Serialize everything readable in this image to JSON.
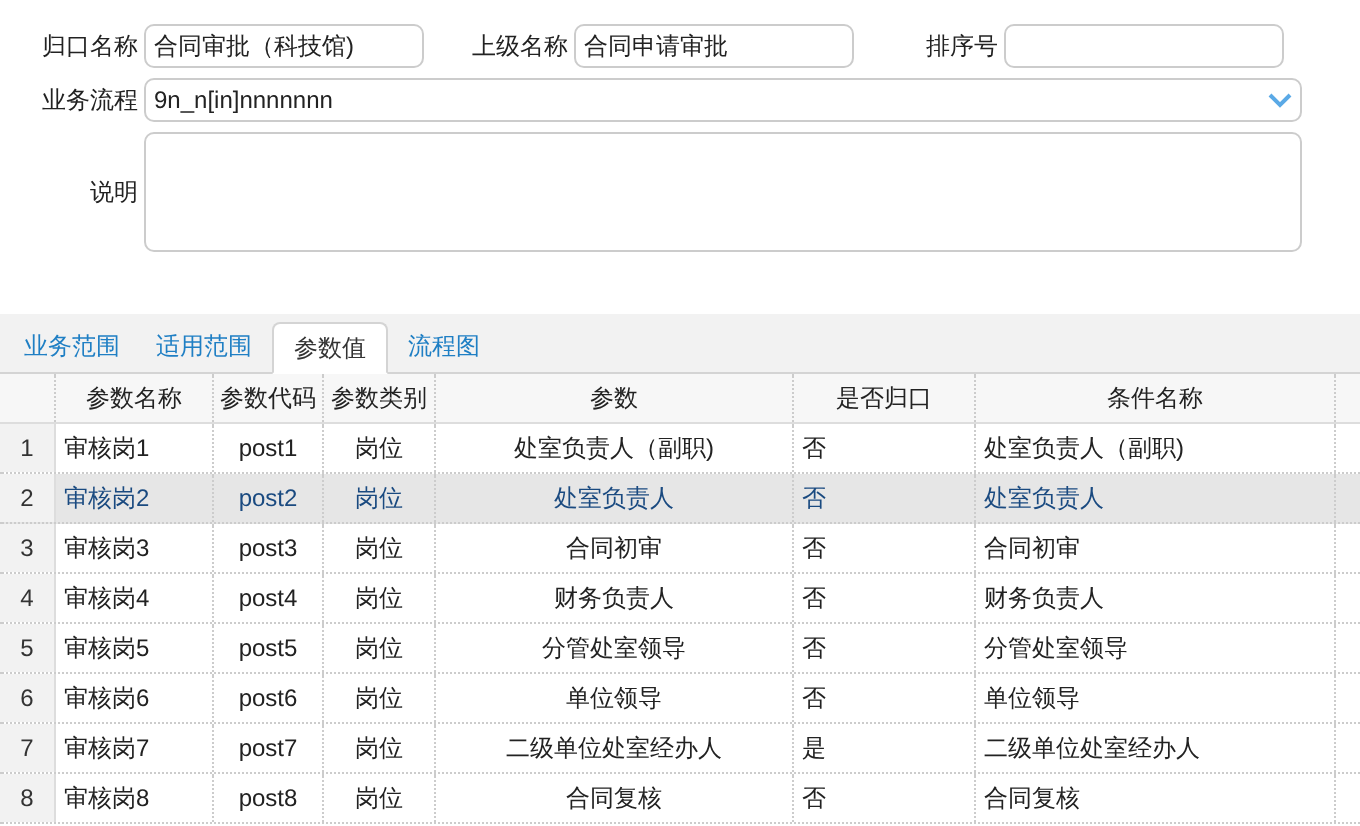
{
  "form": {
    "fields": [
      {
        "label": "归口名称",
        "value": "合同审批（科技馆)"
      },
      {
        "label": "上级名称",
        "value": "合同申请审批"
      },
      {
        "label": "排序号"
      }
    ],
    "process": {
      "label": "业务流程",
      "value": "9n_n[in]nnnnnnn"
    },
    "description": {
      "label": "说明"
    }
  },
  "tabs": [
    {
      "label": "业务范围",
      "selected": false
    },
    {
      "label": "适用范围",
      "selected": false
    },
    {
      "label": "参数值",
      "selected": true
    },
    {
      "label": "流程图",
      "selected": false
    }
  ],
  "table": {
    "columns": [
      "参数名称",
      "参数代码",
      "参数类别",
      "参数",
      "是否归口",
      "条件名称"
    ],
    "rows": [
      {
        "num": "1",
        "cells": [
          "审核岗1",
          "post1",
          "岗位",
          "处室负责人（副职)",
          "否",
          "处室负责人（副职)"
        ],
        "selected": false
      },
      {
        "num": "2",
        "cells": [
          "审核岗2",
          "post2",
          "岗位",
          "处室负责人",
          "否",
          "处室负责人"
        ],
        "selected": true
      },
      {
        "num": "3",
        "cells": [
          "审核岗3",
          "post3",
          "岗位",
          "合同初审",
          "否",
          "合同初审"
        ],
        "selected": false
      },
      {
        "num": "4",
        "cells": [
          "审核岗4",
          "post4",
          "岗位",
          "财务负责人",
          "否",
          "财务负责人"
        ],
        "selected": false
      },
      {
        "num": "5",
        "cells": [
          "审核岗5",
          "post5",
          "岗位",
          "分管处室领导",
          "否",
          "分管处室领导"
        ],
        "selected": false
      },
      {
        "num": "6",
        "cells": [
          "审核岗6",
          "post6",
          "岗位",
          "单位领导",
          "否",
          "单位领导"
        ],
        "selected": false
      },
      {
        "num": "7",
        "cells": [
          "审核岗7",
          "post7",
          "岗位",
          "二级单位处室经办人",
          "是",
          "二级单位处室经办人"
        ],
        "selected": false
      },
      {
        "num": "8",
        "cells": [
          "审核岗8",
          "post8",
          "岗位",
          "合同复核",
          "否",
          "合同复核"
        ],
        "selected": false
      }
    ]
  }
}
